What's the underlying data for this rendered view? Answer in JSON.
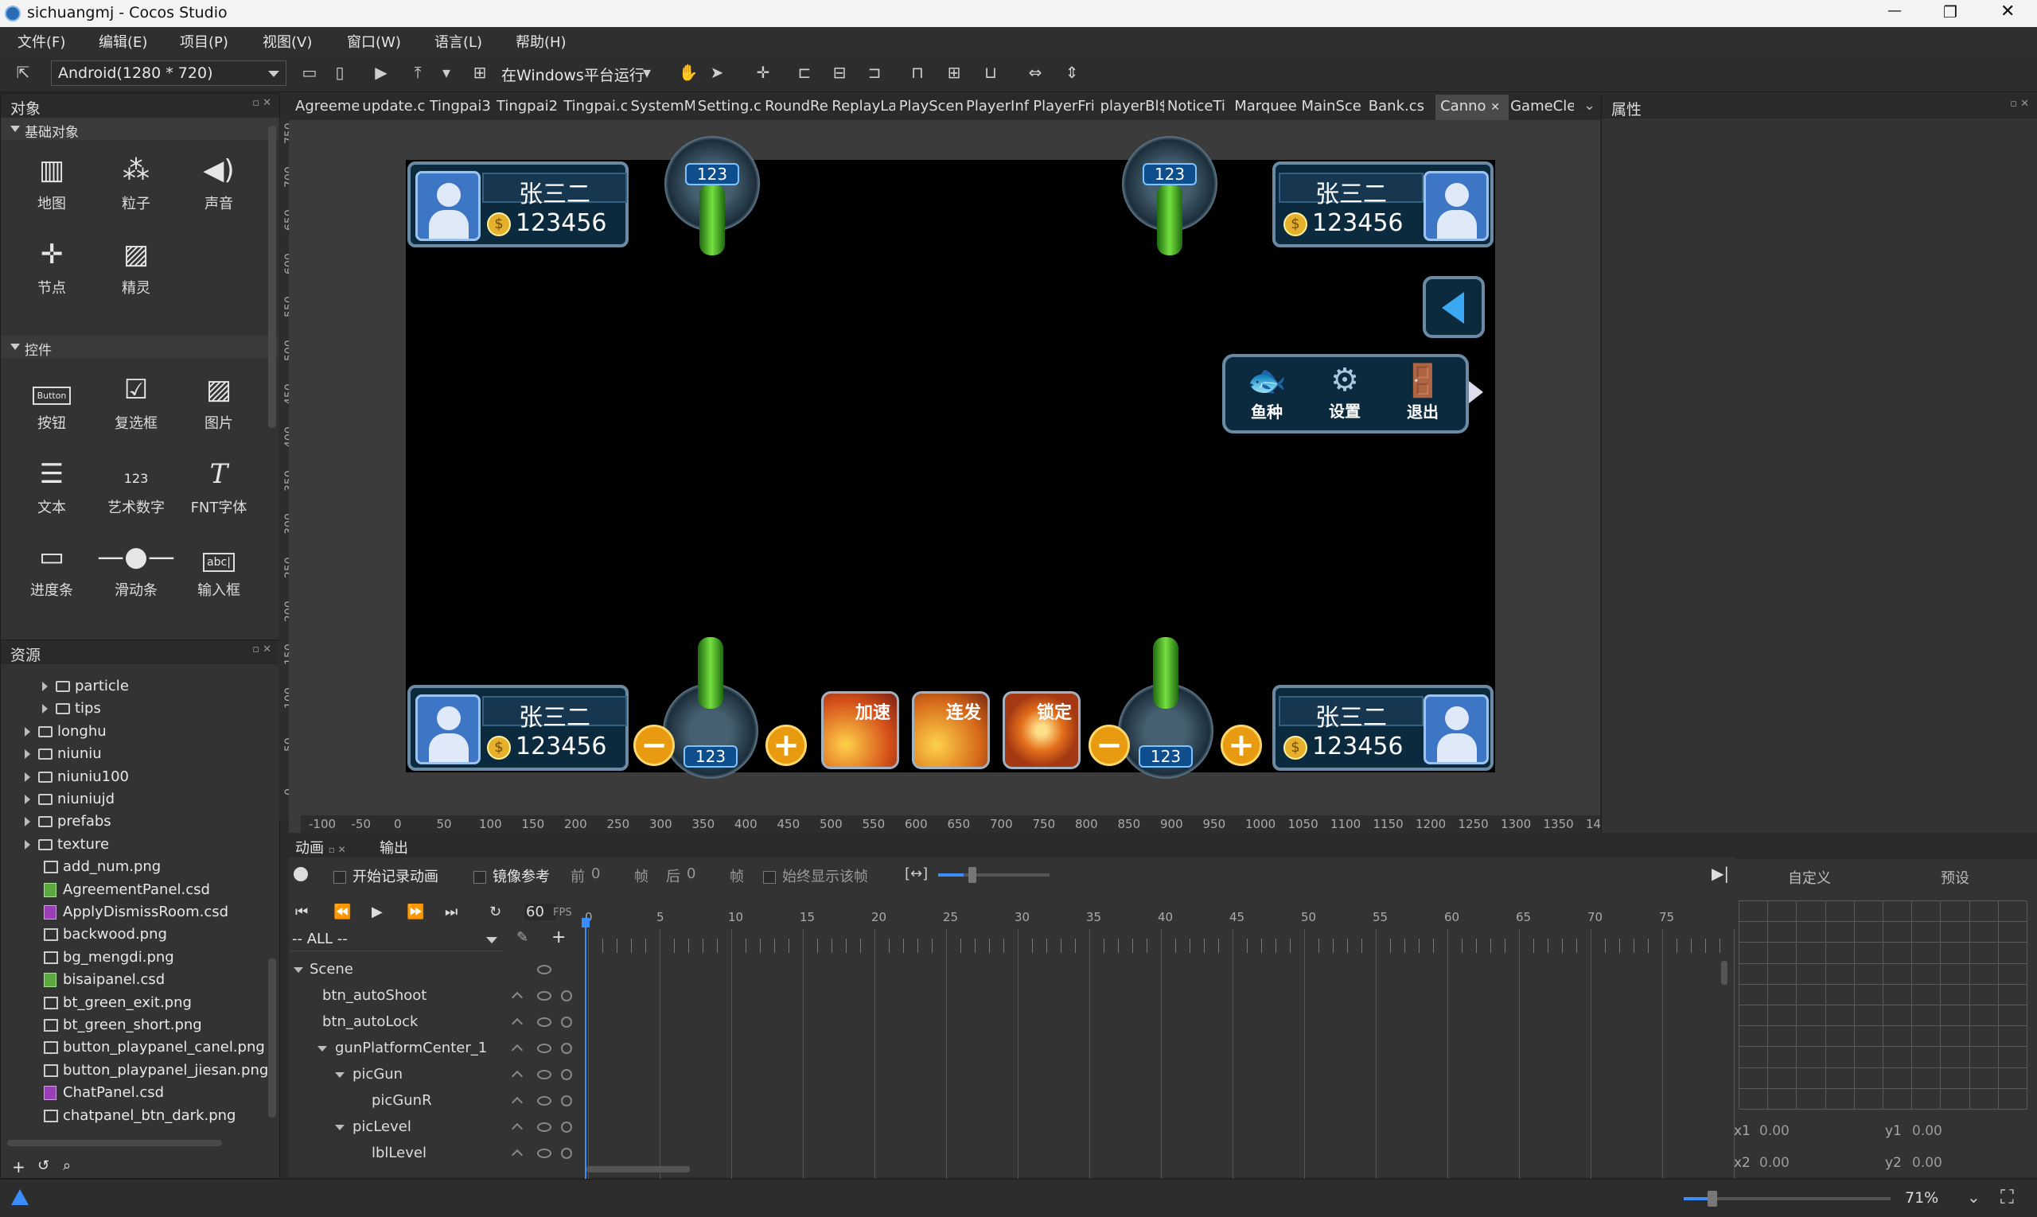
{
  "window": {
    "title": "sichuangmj - Cocos Studio",
    "minimize": "—",
    "restore": "❐",
    "close": "✕"
  },
  "menu": [
    "文件(F)",
    "编辑(E)",
    "项目(P)",
    "视图(V)",
    "窗口(W)",
    "语言(L)",
    "帮助(H)"
  ],
  "toolbar": {
    "resolution": "Android(1280 * 720)",
    "run_label": "在Windows平台运行"
  },
  "objects_panel": {
    "title": "对象",
    "basic_header": "基础对象",
    "basic": [
      {
        "label": "地图",
        "icon": "map-icon"
      },
      {
        "label": "粒子",
        "icon": "particle-icon"
      },
      {
        "label": "声音",
        "icon": "sound-icon"
      },
      {
        "label": "节点",
        "icon": "node-icon"
      },
      {
        "label": "精灵",
        "icon": "sprite-icon"
      }
    ],
    "controls_header": "控件",
    "controls": [
      {
        "label": "按钮",
        "icon": "button-icon"
      },
      {
        "label": "复选框",
        "icon": "checkbox-icon"
      },
      {
        "label": "图片",
        "icon": "image-icon"
      },
      {
        "label": "文本",
        "icon": "text-icon"
      },
      {
        "label": "艺术数字",
        "icon": "art-number-icon"
      },
      {
        "label": "FNT字体",
        "icon": "fnt-font-icon"
      },
      {
        "label": "进度条",
        "icon": "progress-icon"
      },
      {
        "label": "滑动条",
        "icon": "slider-icon"
      },
      {
        "label": "输入框",
        "icon": "input-icon"
      }
    ],
    "button_icon_text": "Button",
    "art_icon_text": "123",
    "input_icon_text": "abc|"
  },
  "resources_panel": {
    "title": "资源",
    "items": [
      {
        "name": "particle",
        "type": "folder",
        "indent": 1
      },
      {
        "name": "tips",
        "type": "folder",
        "indent": 1
      },
      {
        "name": "longhu",
        "type": "folder",
        "indent": 0
      },
      {
        "name": "niuniu",
        "type": "folder",
        "indent": 0
      },
      {
        "name": "niuniu100",
        "type": "folder",
        "indent": 0
      },
      {
        "name": "niuniujd",
        "type": "folder",
        "indent": 0
      },
      {
        "name": "prefabs",
        "type": "folder",
        "indent": 0
      },
      {
        "name": "texture",
        "type": "folder",
        "indent": 0
      },
      {
        "name": "add_num.png",
        "type": "png",
        "indent": 0
      },
      {
        "name": "AgreementPanel.csd",
        "type": "csd-green",
        "indent": 0
      },
      {
        "name": "ApplyDismissRoom.csd",
        "type": "csd",
        "indent": 0
      },
      {
        "name": "backwood.png",
        "type": "png",
        "indent": 0
      },
      {
        "name": "bg_mengdi.png",
        "type": "png",
        "indent": 0
      },
      {
        "name": "bisaipanel.csd",
        "type": "csd-green",
        "indent": 0
      },
      {
        "name": "bt_green_exit.png",
        "type": "png",
        "indent": 0
      },
      {
        "name": "bt_green_short.png",
        "type": "png",
        "indent": 0
      },
      {
        "name": "button_playpanel_canel.png",
        "type": "png",
        "indent": 0
      },
      {
        "name": "button_playpanel_jiesan.png",
        "type": "png",
        "indent": 0
      },
      {
        "name": "ChatPanel.csd",
        "type": "csd",
        "indent": 0
      },
      {
        "name": "chatpanel_btn_dark.png",
        "type": "png",
        "indent": 0
      }
    ]
  },
  "tabs": [
    "Agreeme",
    "update.c",
    "Tingpai3",
    "Tingpai2",
    "Tingpai.c",
    "SystemM",
    "Setting.c",
    "RoundRe",
    "ReplayLa",
    "PlayScen",
    "PlayerInf",
    "PlayerFri",
    "playerBl$",
    "NoticeTi",
    "Marquee",
    "MainSce",
    "Bank.cs",
    "Canno",
    "GameCle"
  ],
  "active_tab_index": 17,
  "properties_panel": {
    "title": "属性"
  },
  "ruler_y": [
    "750",
    "700",
    "650",
    "600",
    "550",
    "500",
    "450",
    "400",
    "350",
    "300",
    "250",
    "200",
    "150",
    "100",
    "50",
    "0"
  ],
  "ruler_x": [
    "-100",
    "-50",
    "0",
    "50",
    "100",
    "150",
    "200",
    "250",
    "300",
    "350",
    "400",
    "450",
    "500",
    "550",
    "600",
    "650",
    "700",
    "750",
    "800",
    "850",
    "900",
    "950",
    "1000",
    "1050",
    "1100",
    "1150",
    "1200",
    "1250",
    "1300",
    "1350",
    "14"
  ],
  "game": {
    "player_name": "张三二",
    "player_coins": "123456",
    "gun_level": "123",
    "menu_buttons": [
      "鱼种",
      "设置",
      "退出"
    ],
    "skills": [
      "加速",
      "连发",
      "锁定"
    ]
  },
  "timeline": {
    "tabs": [
      "动画",
      "输出"
    ],
    "record_label": "开始记录动画",
    "mirror_label": "镜像参考",
    "before_label": "前",
    "before_value": "0",
    "frame_label": "帧",
    "after_label": "后",
    "after_value": "0",
    "always_show_label": "始终显示该帧",
    "fps_value": "60",
    "fps_label": "FPS",
    "filter": "-- ALL --",
    "frame_ticks": [
      "0",
      "5",
      "10",
      "15",
      "20",
      "25",
      "30",
      "35",
      "40",
      "45",
      "50",
      "55",
      "60",
      "65",
      "70",
      "75"
    ],
    "nodes": [
      {
        "name": "Scene",
        "indent": 0,
        "expanded": true
      },
      {
        "name": "btn_autoShoot",
        "indent": 1
      },
      {
        "name": "btn_autoLock",
        "indent": 1
      },
      {
        "name": "gunPlatformCenter_1",
        "indent": 1,
        "expanded": true
      },
      {
        "name": "picGun",
        "indent": 2,
        "expanded": true
      },
      {
        "name": "picGunR",
        "indent": 3
      },
      {
        "name": "picLevel",
        "indent": 2,
        "expanded": true
      },
      {
        "name": "lblLevel",
        "indent": 3
      }
    ]
  },
  "curve_panel": {
    "tab_custom": "自定义",
    "tab_preset": "预设",
    "x1_label": "x1",
    "x1": "0.00",
    "y1_label": "y1",
    "y1": "0.00",
    "x2_label": "x2",
    "x2": "0.00",
    "y2_label": "y2",
    "y2": "0.00"
  },
  "status": {
    "zoom": "71%"
  }
}
